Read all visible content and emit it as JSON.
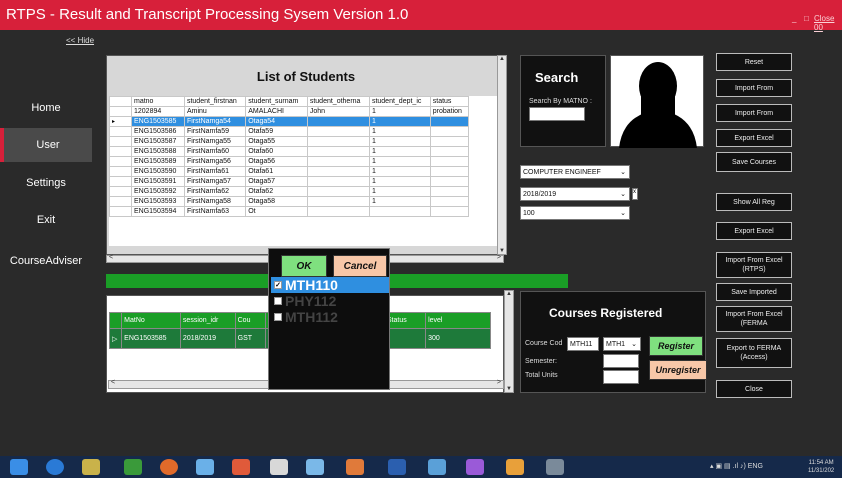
{
  "window": {
    "title": "RTPS - Result and Transcript Processing Sysem Version 1.0",
    "minimize": "_",
    "restore": "□",
    "close_label": "Close 00"
  },
  "nav": {
    "hide_link": "<< Hide",
    "items": [
      "Home",
      "User",
      "Settings",
      "Exit",
      "CourseAdviser"
    ],
    "active": "User"
  },
  "students": {
    "title": "List of Students",
    "columns": [
      "matno",
      "student_firstnan",
      "student_surnam",
      "student_otherna",
      "student_dept_ic",
      "status"
    ],
    "rows": [
      [
        "1202894",
        "Aminu",
        "AMALACHI",
        "John",
        "1",
        "probation"
      ],
      [
        "ENG1503585",
        "FirstNamga54",
        "Otaga54",
        "",
        "1",
        ""
      ],
      [
        "ENG1503586",
        "FirstNamfa59",
        "Otafa59",
        "",
        "1",
        ""
      ],
      [
        "ENG1503587",
        "FirstNamga55",
        "Otaga55",
        "",
        "1",
        ""
      ],
      [
        "ENG1503588",
        "FirstNamfa60",
        "Otafa60",
        "",
        "1",
        ""
      ],
      [
        "ENG1503589",
        "FirstNamga56",
        "Otaga56",
        "",
        "1",
        ""
      ],
      [
        "ENG1503590",
        "FirstNamfa61",
        "Otafa61",
        "",
        "1",
        ""
      ],
      [
        "ENG1503591",
        "FirstNamga57",
        "Otaga57",
        "",
        "1",
        ""
      ],
      [
        "ENG1503592",
        "FirstNamfa62",
        "Otafa62",
        "",
        "1",
        ""
      ],
      [
        "ENG1503593",
        "FirstNamga58",
        "Otaga58",
        "",
        "1",
        ""
      ],
      [
        "ENG1503594",
        "FirstNamfa63",
        "Ot",
        "",
        "",
        ""
      ]
    ],
    "selected_row": 1
  },
  "progress": {
    "fraction": 1.0
  },
  "registrations": {
    "columns": [
      "MatNo",
      "session_idr",
      "Cou",
      "",
      "s_Status",
      "level"
    ],
    "rows": [
      [
        "ENG1503585",
        "2018/2019",
        "GST",
        "",
        "■",
        "300"
      ]
    ]
  },
  "popup": {
    "ok_label": "OK",
    "cancel_label": "Cancel",
    "items": [
      {
        "label": "MTH110",
        "checked": true,
        "selected": true
      },
      {
        "label": "PHY112",
        "checked": false,
        "selected": false
      },
      {
        "label": "MTH112",
        "checked": false,
        "selected": false
      }
    ]
  },
  "search": {
    "title": "Search",
    "label": "Search By MATNO :",
    "value": ""
  },
  "filters": {
    "department": "COMPUTER ENGINEEF",
    "session": "2018/2019",
    "level": "100",
    "spin": "x"
  },
  "courses": {
    "title": "Courses Registered",
    "course_code_label": "Course Cod",
    "course_code_value": "MTH11",
    "course_select": "MTH1",
    "semester_label": "Semester:",
    "semester_value": "",
    "total_units_label": "Total Units",
    "total_units_value": "",
    "register_label": "Register",
    "unregister_label": "Unregister"
  },
  "actions": [
    "Reset",
    "Import From",
    "Import From",
    "Export Excel",
    "Save Courses",
    "Show All Reg",
    "Export Excel",
    "Import From Excel (RTPS)",
    "Save Imported",
    "Import From Excel (FERMA",
    "Export to FERMA (Access)",
    "Close"
  ],
  "taskbar": {
    "tray_lang": "ENG",
    "time": "11:54 AM",
    "date": "11/31/202"
  },
  "colors": {
    "title_bar": "#d7203a",
    "accent_green": "#1a9e26",
    "selection_blue": "#2f8fe0",
    "ok_green": "#7fe07f",
    "cancel_peach": "#f7c7a8"
  }
}
